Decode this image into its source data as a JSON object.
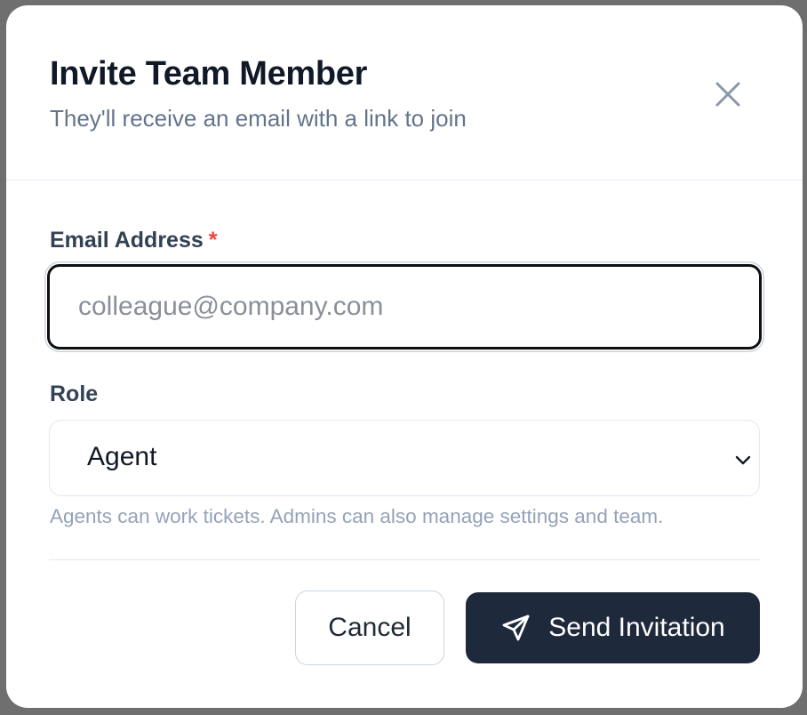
{
  "dialog": {
    "title": "Invite Team Member",
    "subtitle": "They'll receive an email with a link to join",
    "close_icon": "close-icon"
  },
  "email": {
    "label": "Email Address",
    "required_marker": "*",
    "placeholder": "colleague@company.com",
    "value": ""
  },
  "role": {
    "label": "Role",
    "selected": "Agent",
    "hint": "Agents can work tickets. Admins can also manage settings and team."
  },
  "actions": {
    "cancel_label": "Cancel",
    "send_label": "Send Invitation",
    "send_icon": "paper-plane-icon"
  },
  "colors": {
    "primary": "#1e293b",
    "required": "#ef4444",
    "muted": "#64748b"
  }
}
